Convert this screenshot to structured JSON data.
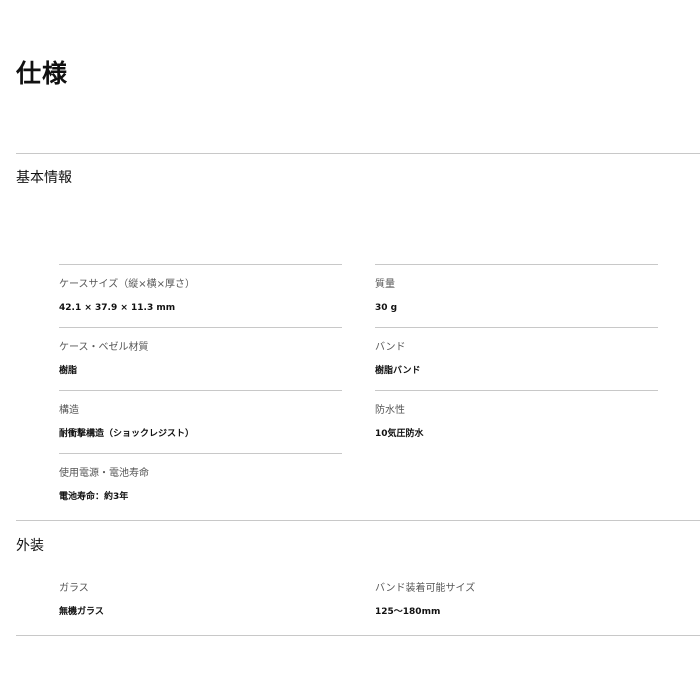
{
  "page": {
    "title": "仕様"
  },
  "sections": {
    "basic": {
      "title": "基本情報",
      "items": {
        "case_size": {
          "label": "ケースサイズ（縦×横×厚さ）",
          "value": "42.1 × 37.9 × 11.3 mm"
        },
        "weight": {
          "label": "質量",
          "value": "30 g"
        },
        "case_bezel": {
          "label": "ケース・ベゼル材質",
          "value": "樹脂"
        },
        "band": {
          "label": "バンド",
          "value": "樹脂バンド"
        },
        "structure": {
          "label": "構造",
          "value": "耐衝撃構造（ショックレジスト）"
        },
        "water": {
          "label": "防水性",
          "value": "10気圧防水"
        },
        "power": {
          "label": "使用電源・電池寿命",
          "value": "電池寿命：約3年"
        }
      }
    },
    "exterior": {
      "title": "外装",
      "items": {
        "glass": {
          "label": "ガラス",
          "value": "無機ガラス"
        },
        "band_size": {
          "label": "バンド装着可能サイズ",
          "value": "125〜180mm"
        }
      }
    }
  }
}
